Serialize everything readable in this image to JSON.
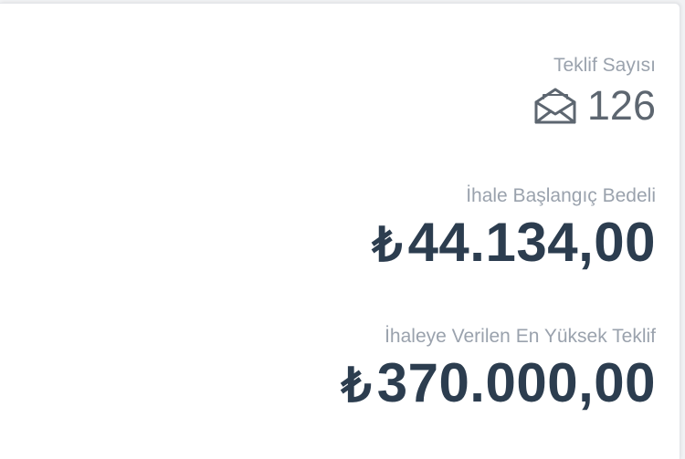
{
  "stats": {
    "offer_count": {
      "label": "Teklif Sayısı",
      "value": "126",
      "icon": "envelope-open-icon"
    },
    "start_price": {
      "label": "İhale Başlangıç Bedeli",
      "currency": "₺",
      "value": "44.134,00"
    },
    "highest_offer": {
      "label": "İhaleye Verilen En Yüksek Teklif",
      "currency": "₺",
      "value": "370.000,00"
    }
  },
  "colors": {
    "label": "#9aa2ad",
    "amount": "#2c3d4f",
    "count": "#5d6670"
  }
}
